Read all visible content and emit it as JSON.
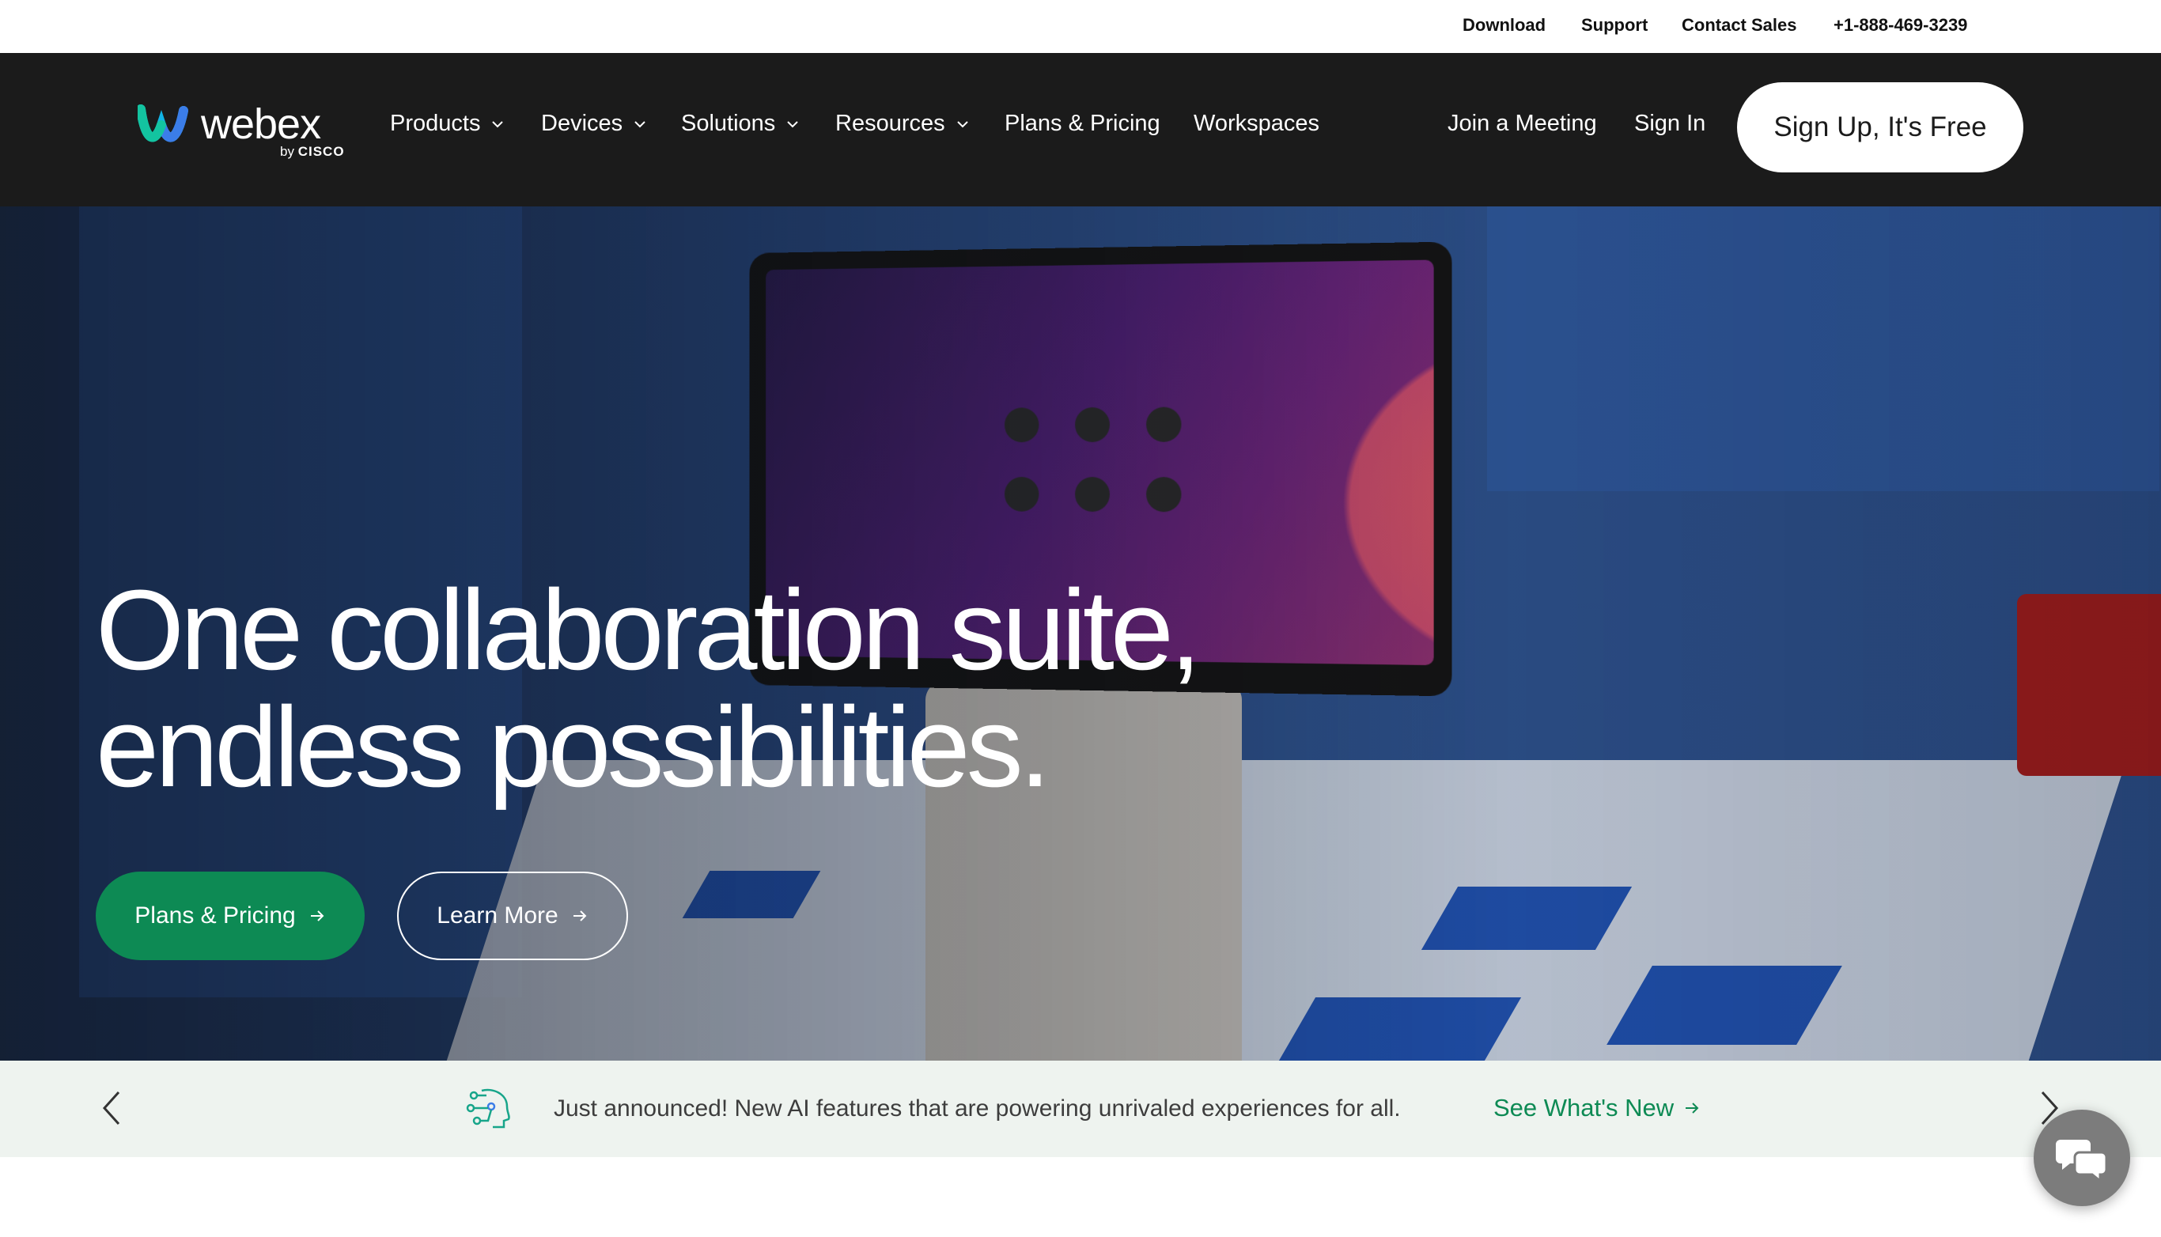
{
  "utility": {
    "download": "Download",
    "support": "Support",
    "contact_sales": "Contact Sales",
    "phone": "+1-888-469-3239"
  },
  "brand": {
    "name": "webex",
    "by": "by",
    "parent": "CISCO"
  },
  "nav": {
    "products": "Products",
    "devices": "Devices",
    "solutions": "Solutions",
    "resources": "Resources",
    "plans": "Plans & Pricing",
    "workspaces": "Workspaces",
    "join": "Join a Meeting",
    "signin": "Sign In",
    "signup": "Sign Up, It's Free"
  },
  "hero": {
    "title_line1": "One collaboration suite,",
    "title_line2": "endless possibilities.",
    "cta_primary": "Plans & Pricing",
    "cta_secondary": "Learn More"
  },
  "announcement": {
    "text": "Just announced! New AI features that are powering unrivaled experiences for all.",
    "link": "See What's New"
  },
  "colors": {
    "nav_bg": "#1b1b1b",
    "accent_green": "#0d8a54",
    "announce_bg": "#eef3ef",
    "chat_bg": "#7c7c7c"
  },
  "icons": [
    "webex-logo-icon",
    "chevron-down-icon",
    "arrow-right-icon",
    "chevron-left-icon",
    "chevron-right-icon",
    "ai-head-icon",
    "chat-icon"
  ]
}
